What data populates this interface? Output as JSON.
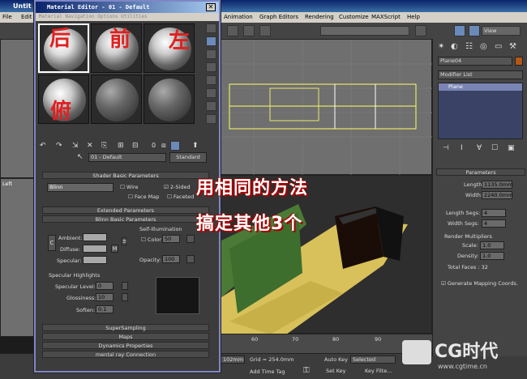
{
  "max": {
    "title": "Untit",
    "menus": [
      "File",
      "Edit",
      "Animation",
      "Graph Editors",
      "Rendering",
      "Customize",
      "MAXScript",
      "Help"
    ],
    "view_dropdown": "View",
    "viewport_left": "Left",
    "timeline": [
      "60",
      "70",
      "80",
      "90"
    ],
    "status": {
      "coords": "102mm",
      "grid": "Grid = 254.0mm",
      "autokey": "Auto Key",
      "selected": "Selected",
      "setkey": "Set Key",
      "keyfilters": "Key Filte...",
      "addtimetag": "Add Time Tag"
    }
  },
  "cmd": {
    "object_name": "Plane04",
    "modifier_list": "Modifier List",
    "stack_item": "Plane",
    "params_header": "Parameters",
    "length_label": "Length:",
    "length_value": "1135.0mm",
    "width_label": "Width:",
    "width_value": "2240.0mm",
    "lsegs_label": "Length Segs:",
    "lsegs_value": "4",
    "wsegs_label": "Width Segs:",
    "wsegs_value": "4",
    "render_mult": "Render Multipliers",
    "scale_label": "Scale:",
    "scale_value": "1.0",
    "density_label": "Density:",
    "density_value": "1.0",
    "total_faces": "Total Faces : 32",
    "gen_map": "Generate Mapping Coords."
  },
  "med": {
    "title": "Material Editor - 01 - Default",
    "menu": "Material  Navigation  Options  Utilities",
    "slot_chars": [
      "后",
      "前",
      "左",
      "俯"
    ],
    "material_name": "01 - Default",
    "type_button": "Standard",
    "shader_header": "Shader Basic Parameters",
    "shader_value": "Blinn",
    "wire": "Wire",
    "two_sided": "2-Sided",
    "face_map": "Face Map",
    "faceted": "Faceted",
    "extended_header": "Extended Parameters",
    "blinn_header": "Blinn Basic Parameters",
    "self_illum": "Self-Illumination",
    "ambient": "Ambient:",
    "diffuse": "Diffuse:",
    "specular": "Specular:",
    "color_label": "Color",
    "color_value": "50",
    "opacity_label": "Opacity:",
    "opacity_value": "100",
    "spec_highlights": "Specular Highlights",
    "spec_level_label": "Specular Level:",
    "spec_level_value": "0",
    "gloss_label": "Glossiness:",
    "gloss_value": "10",
    "soften_label": "Soften:",
    "soften_value": "0.1",
    "rollouts": [
      "SuperSampling",
      "Maps",
      "Dynamics Properties",
      "mental ray Connection"
    ],
    "letter_c": "C",
    "letter_m": "M"
  },
  "overlay": {
    "line1": "用相同的方法",
    "line2": "搞定其他3个"
  },
  "logo": {
    "text": "CG时代",
    "url": "www.cgtime.cn"
  }
}
